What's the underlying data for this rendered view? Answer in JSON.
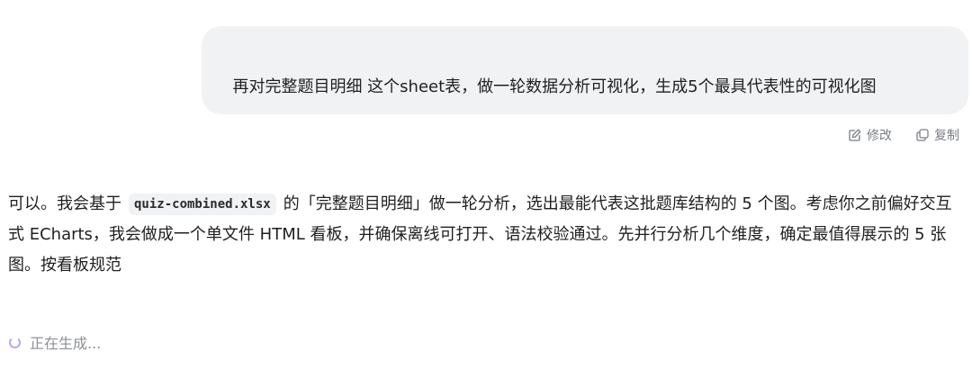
{
  "user_message": {
    "text": "再对完整题目明细 这个sheet表，做一轮数据分析可视化，生成5个最具代表性的可视化图"
  },
  "message_actions": {
    "edit_label": "修改",
    "copy_label": "复制"
  },
  "assistant_message": {
    "part1": "可以。我会基于",
    "filename": "quiz-combined.xlsx",
    "part2": "的「完整题目明细」做一轮分析，选出最能代表这批题库结构的 5 个图。考虑你之前偏好交互式 ECharts，我会做成一个单文件 HTML 看板，并确保离线可打开、语法校验通过。先并行分析几个维度，确定最值得展示的 5 张图。按看板规范"
  },
  "status": {
    "label": "正在生成..."
  },
  "colors": {
    "bubble_bg": "#f1f2f4",
    "spinner": "#b9a6f5",
    "muted_text": "#7a7e86"
  }
}
